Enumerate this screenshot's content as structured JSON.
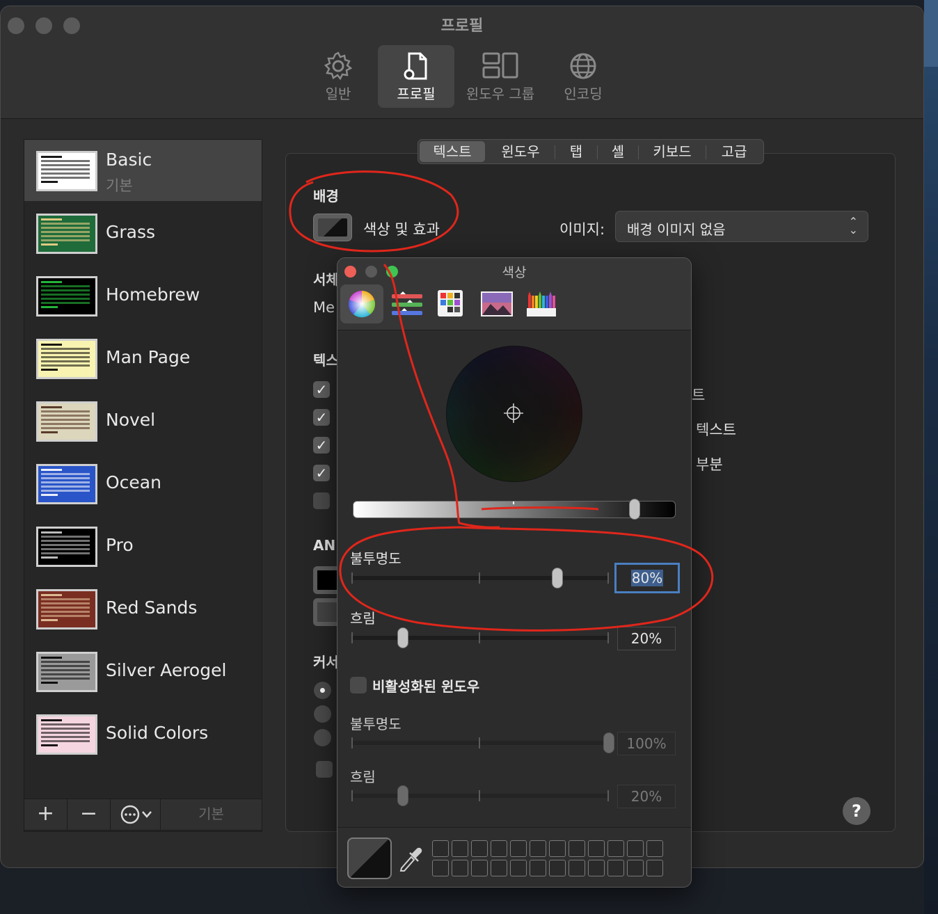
{
  "window": {
    "title": "프로필"
  },
  "toolbar": {
    "items": [
      {
        "label": "일반",
        "icon": "gear-icon"
      },
      {
        "label": "프로필",
        "icon": "profile-doc-icon"
      },
      {
        "label": "윈도우 그룹",
        "icon": "window-group-icon"
      },
      {
        "label": "인코딩",
        "icon": "globe-icon"
      }
    ],
    "selected": "프로필"
  },
  "profiles": [
    {
      "name": "Basic",
      "subtitle": "기본",
      "bg": "#ffffff",
      "fg": "#000000"
    },
    {
      "name": "Grass",
      "bg": "#1f6b3a",
      "fg": "#f5d58a"
    },
    {
      "name": "Homebrew",
      "bg": "#000000",
      "fg": "#28c840"
    },
    {
      "name": "Man Page",
      "bg": "#f8f3b0",
      "fg": "#000000"
    },
    {
      "name": "Novel",
      "bg": "#dcd6bc",
      "fg": "#4b2a18"
    },
    {
      "name": "Ocean",
      "bg": "#2a55c8",
      "fg": "#ffffff"
    },
    {
      "name": "Pro",
      "bg": "#000000",
      "fg": "#cfcfcf"
    },
    {
      "name": "Red Sands",
      "bg": "#7a2e22",
      "fg": "#e8c9a0"
    },
    {
      "name": "Silver Aerogel",
      "bg": "#9a9a9a",
      "fg": "#000000"
    },
    {
      "name": "Solid Colors",
      "bg": "#f5d6e0",
      "fg": "#000000"
    }
  ],
  "sidebar_buttons": {
    "add": "+",
    "remove": "−",
    "default": "기본"
  },
  "tabs": [
    {
      "label": "텍스트",
      "selected": true
    },
    {
      "label": "윈도우"
    },
    {
      "label": "탭"
    },
    {
      "label": "셸"
    },
    {
      "label": "키보드"
    },
    {
      "label": "고급"
    }
  ],
  "background_section": {
    "heading": "배경",
    "color_effects_label": "색상 및 효과",
    "image_label": "이미지:",
    "image_value": "배경 이미지 없음"
  },
  "partial_labels": {
    "font_heading": "서체",
    "font_value": "Me",
    "text_heading": "텍스",
    "ansi_heading": "AN",
    "cursor_heading": "커서",
    "right_1": "트",
    "right_2": "텍스트",
    "right_3": "부분"
  },
  "checkboxes": [
    true,
    true,
    true,
    true,
    false
  ],
  "color_panel": {
    "title": "색상",
    "opacity_label": "불투명도",
    "opacity_value": "80%",
    "opacity_fraction": 0.8,
    "blur_label": "흐림",
    "blur_value": "20%",
    "blur_fraction": 0.2,
    "inactive_checkbox_label": "비활성화된 윈도우",
    "inactive_opacity_label": "불투명도",
    "inactive_opacity_value": "100%",
    "inactive_opacity_fraction": 1.0,
    "inactive_blur_label": "흐림",
    "inactive_blur_value": "20%",
    "inactive_blur_fraction": 0.2,
    "brightness_fraction": 0.87
  },
  "colors": {
    "annotation": "#e0261b",
    "focus_ring": "#4a7fc0",
    "close": "#ed5f57",
    "minimize": "#5a5a5a",
    "zoom": "#3fc451"
  }
}
